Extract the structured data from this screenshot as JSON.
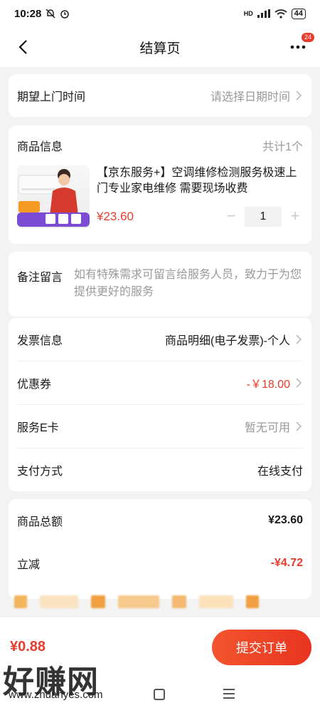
{
  "status": {
    "time": "10:28",
    "signal": "HD",
    "battery": "44"
  },
  "header": {
    "title": "结算页",
    "badge": "24"
  },
  "visit_time": {
    "label": "期望上门时间",
    "placeholder": "请选择日期时间"
  },
  "goods": {
    "label": "商品信息",
    "count": "共计1个",
    "title": "【京东服务+】空调维修检测服务极速上门专业家电维修 需要现场收费",
    "price": "¥23.60",
    "quantity": "1",
    "minus": "−",
    "plus": "+"
  },
  "remark": {
    "label": "备注留言",
    "placeholder": "如有特殊需求可留言给服务人员，致力于为您提供更好的服务"
  },
  "invoice": {
    "label": "发票信息",
    "value": "商品明细(电子发票)-个人"
  },
  "coupon": {
    "label": "优惠券",
    "value": "-￥18.00"
  },
  "ecard": {
    "label": "服务E卡",
    "value": "暂无可用"
  },
  "payment": {
    "label": "支付方式",
    "value": "在线支付"
  },
  "summary": {
    "total_label": "商品总额",
    "total_value": "¥23.60",
    "discount_label": "立减",
    "discount_value": "-¥4.72"
  },
  "bottom": {
    "pay_amount": "¥0.88",
    "submit_label": "提交订单"
  },
  "watermark": {
    "logo": "好赚网",
    "url": "www.zhuanyes.com"
  },
  "colors": {
    "accent": "#e93b2d",
    "background": "#f3f3f3"
  }
}
